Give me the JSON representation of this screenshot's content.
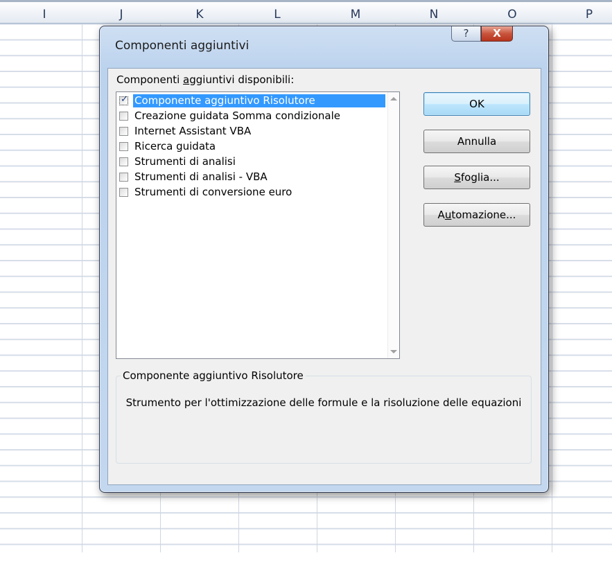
{
  "sheet": {
    "columns": [
      "I",
      "J",
      "K",
      "L",
      "M",
      "N",
      "O",
      "P"
    ]
  },
  "dialog": {
    "title": "Componenti aggiuntivi",
    "help_label": "?",
    "close_label": "X",
    "list_label_pre": "Componenti ",
    "list_label_accel": "a",
    "list_label_post": "ggiuntivi disponibili:",
    "addins": [
      {
        "label": "Componente aggiuntivo Risolutore",
        "checked": true,
        "selected": true
      },
      {
        "label": "Creazione guidata Somma condizionale",
        "checked": false,
        "selected": false
      },
      {
        "label": "Internet Assistant VBA",
        "checked": false,
        "selected": false
      },
      {
        "label": "Ricerca guidata",
        "checked": false,
        "selected": false
      },
      {
        "label": "Strumenti di analisi",
        "checked": false,
        "selected": false
      },
      {
        "label": "Strumenti di analisi - VBA",
        "checked": false,
        "selected": false
      },
      {
        "label": "Strumenti di conversione euro",
        "checked": false,
        "selected": false
      }
    ],
    "buttons": {
      "ok": "OK",
      "cancel": "Annulla",
      "browse_accel": "S",
      "browse_rest": "foglia...",
      "automation_pre": "A",
      "automation_accel": "u",
      "automation_rest": "tomazione..."
    },
    "description": {
      "title": "Componente aggiuntivo Risolutore",
      "text": "Strumento per l'ottimizzazione delle formule e la risoluzione delle equazioni"
    }
  }
}
